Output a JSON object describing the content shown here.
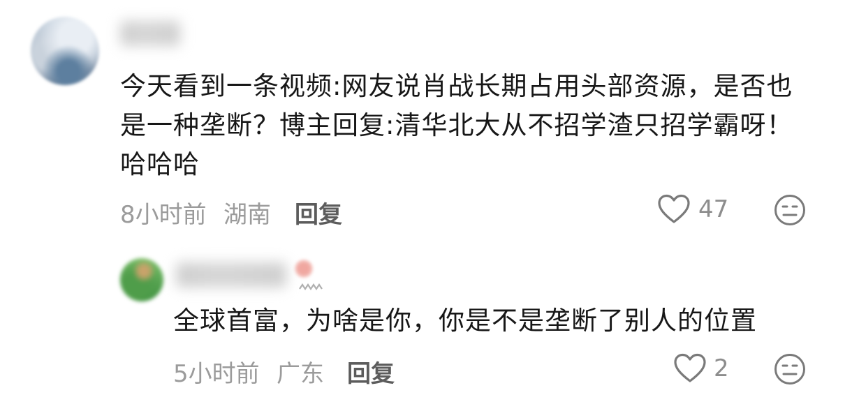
{
  "comments": [
    {
      "text": "今天看到一条视频:网友说肖战长期占用头部资源，是否也是一种垄断？博主回复:清华北大从不招学渣只招学霸呀！哈哈哈",
      "time": "8小时前",
      "location": "湖南",
      "reply_label": "回复",
      "like_count": "47"
    },
    {
      "text": "全球首富，为啥是你，你是不是垄断了别人的位置",
      "time": "5小时前",
      "location": "广东",
      "reply_label": "回复",
      "like_count": "2"
    }
  ],
  "icons": {
    "like": "heart-outline-icon",
    "dislike": "neutral-face-icon",
    "badge": "zigzag-badge-icon"
  },
  "colors": {
    "text": "#171717",
    "meta": "#9b9b9b",
    "reply": "#5c5c5c",
    "icon": "#7a7a7a"
  }
}
